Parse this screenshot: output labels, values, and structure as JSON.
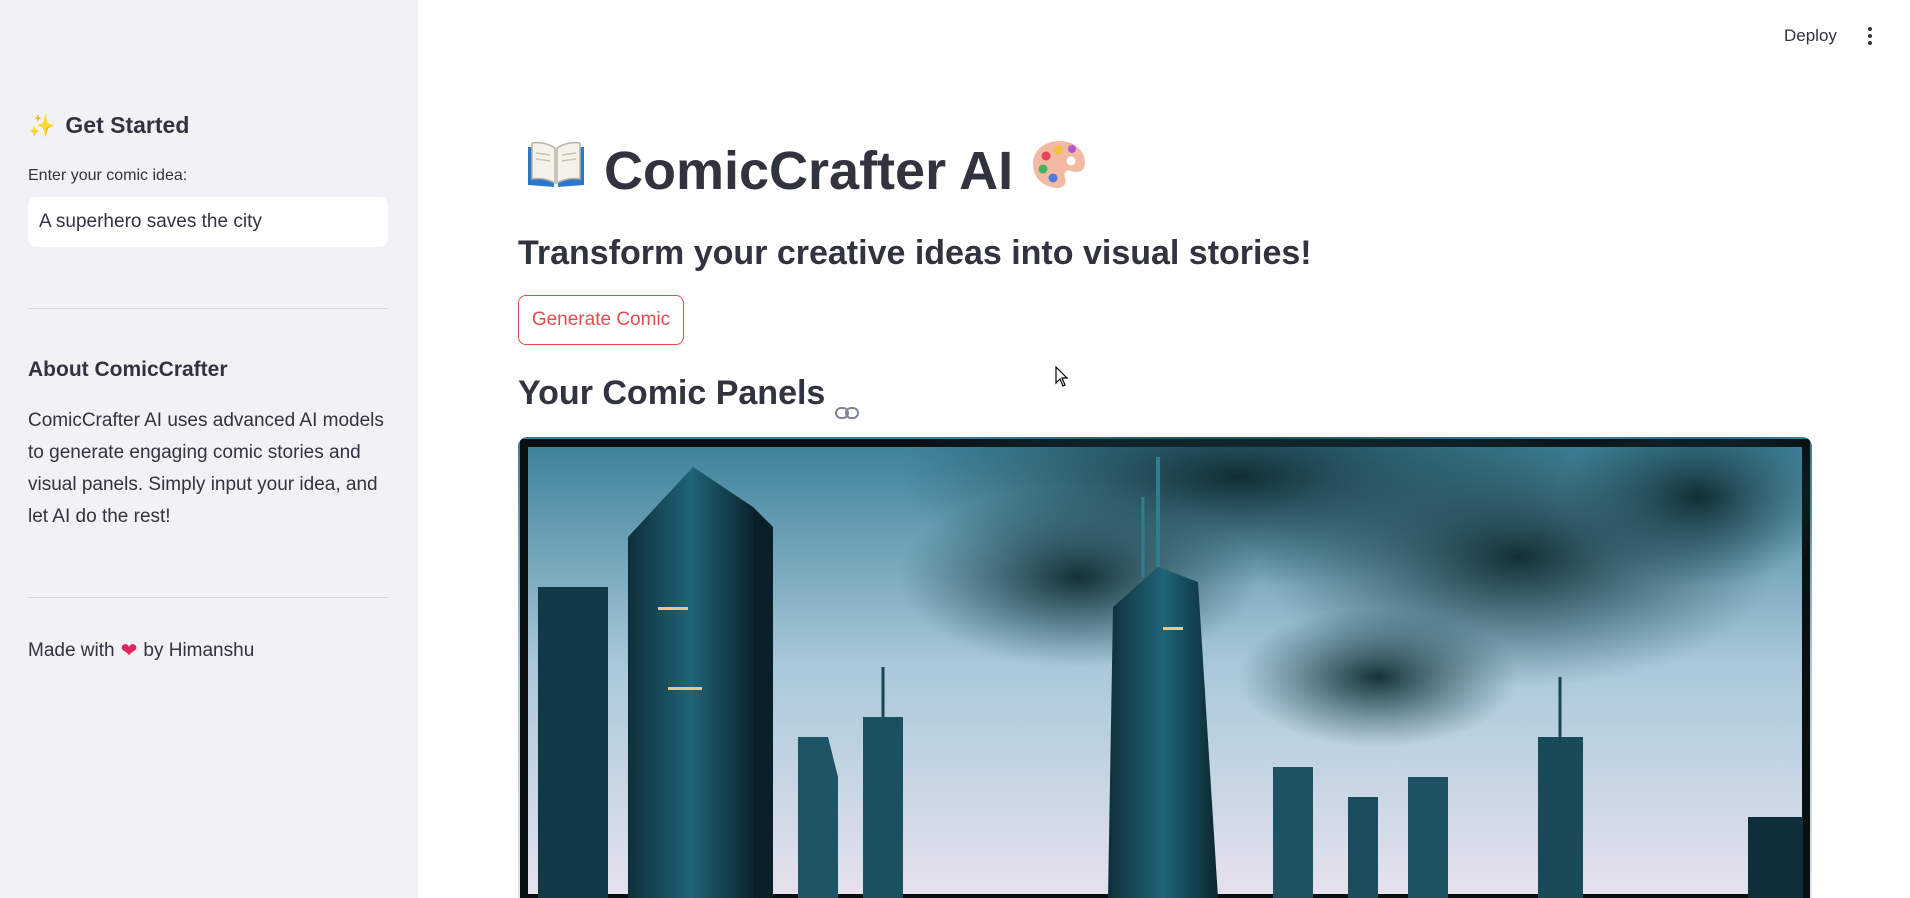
{
  "sidebar": {
    "get_started_icon": "sparkles-icon",
    "get_started_title": "Get Started",
    "idea_label": "Enter your comic idea:",
    "idea_value": "A superhero saves the city",
    "about_title": "About ComicCrafter",
    "about_text": "ComicCrafter AI uses advanced AI models to generate engaging comic stories and visual panels. Simply input your idea, and let AI do the rest!",
    "made_with_prefix": "Made with",
    "made_with_icon": "heart-icon",
    "made_with_suffix": "by Himanshu"
  },
  "header": {
    "deploy_label": "Deploy",
    "menu_icon": "kebab-menu-icon"
  },
  "main": {
    "title_icon_left": "open-book-icon",
    "title": "ComicCrafter AI",
    "title_icon_right": "artist-palette-icon",
    "subtitle": "Transform your creative ideas into visual stories!",
    "generate_button_label": "Generate Comic",
    "panels_heading": "Your Comic Panels",
    "panels_heading_icon": "link-icon",
    "panel_image": "comic-panel-city-skyline-image"
  },
  "colors": {
    "sidebar_bg": "#f0f2f6",
    "text": "#31333f",
    "primary_accent": "#e04d4d",
    "heart": "#e0245e"
  }
}
